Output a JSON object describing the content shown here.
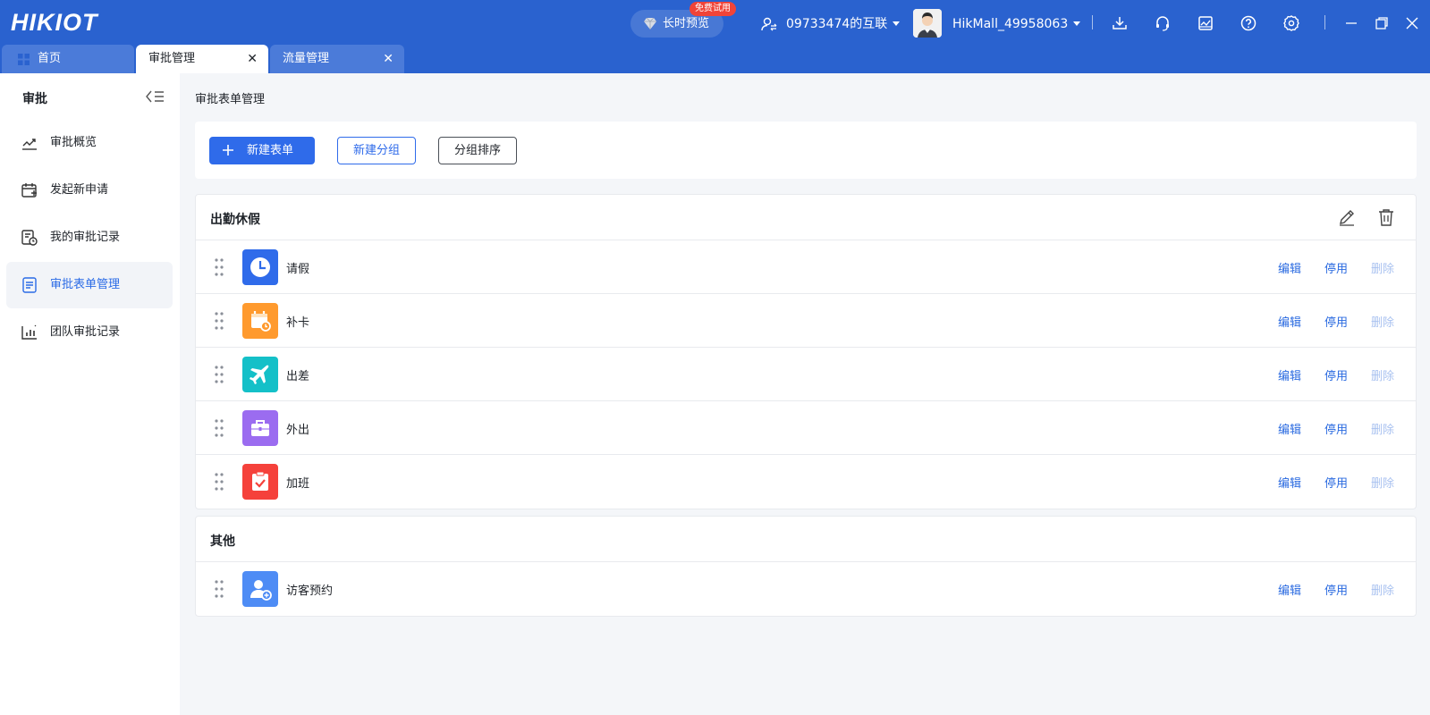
{
  "app": {
    "logo": "HIKIOT"
  },
  "header": {
    "trial_label": "长时预览",
    "trial_badge": "免费试用",
    "org_name": "09733474的互联",
    "user_name": "HikMall_49958063",
    "icons": [
      "download-icon",
      "headset-icon",
      "monitor-icon",
      "help-icon",
      "gear-icon",
      "minimize-icon",
      "restore-icon",
      "close-icon"
    ]
  },
  "tabs": [
    {
      "label": "首页"
    },
    {
      "label": "审批管理"
    },
    {
      "label": "流量管理"
    }
  ],
  "sidebar": {
    "title": "审批",
    "items": [
      {
        "label": "审批概览"
      },
      {
        "label": "发起新申请"
      },
      {
        "label": "我的审批记录"
      },
      {
        "label": "审批表单管理"
      },
      {
        "label": "团队审批记录"
      }
    ]
  },
  "main": {
    "breadcrumb": "审批表单管理",
    "toolbar": {
      "new_form": "新建表单",
      "new_group": "新建分组",
      "sort_group": "分组排序"
    },
    "actions": {
      "edit": "编辑",
      "disable": "停用",
      "delete": "删除"
    },
    "groups": [
      {
        "name": "出勤休假",
        "forms": [
          {
            "name": "请假",
            "color": "#2f6bea"
          },
          {
            "name": "补卡",
            "color": "#ff9a2e"
          },
          {
            "name": "出差",
            "color": "#14c0c8"
          },
          {
            "name": "外出",
            "color": "#9b6cf0"
          },
          {
            "name": "加班",
            "color": "#f5413b"
          }
        ]
      },
      {
        "name": "其他",
        "forms": [
          {
            "name": "访客预约",
            "color": "#4e8cf5"
          }
        ]
      }
    ]
  }
}
